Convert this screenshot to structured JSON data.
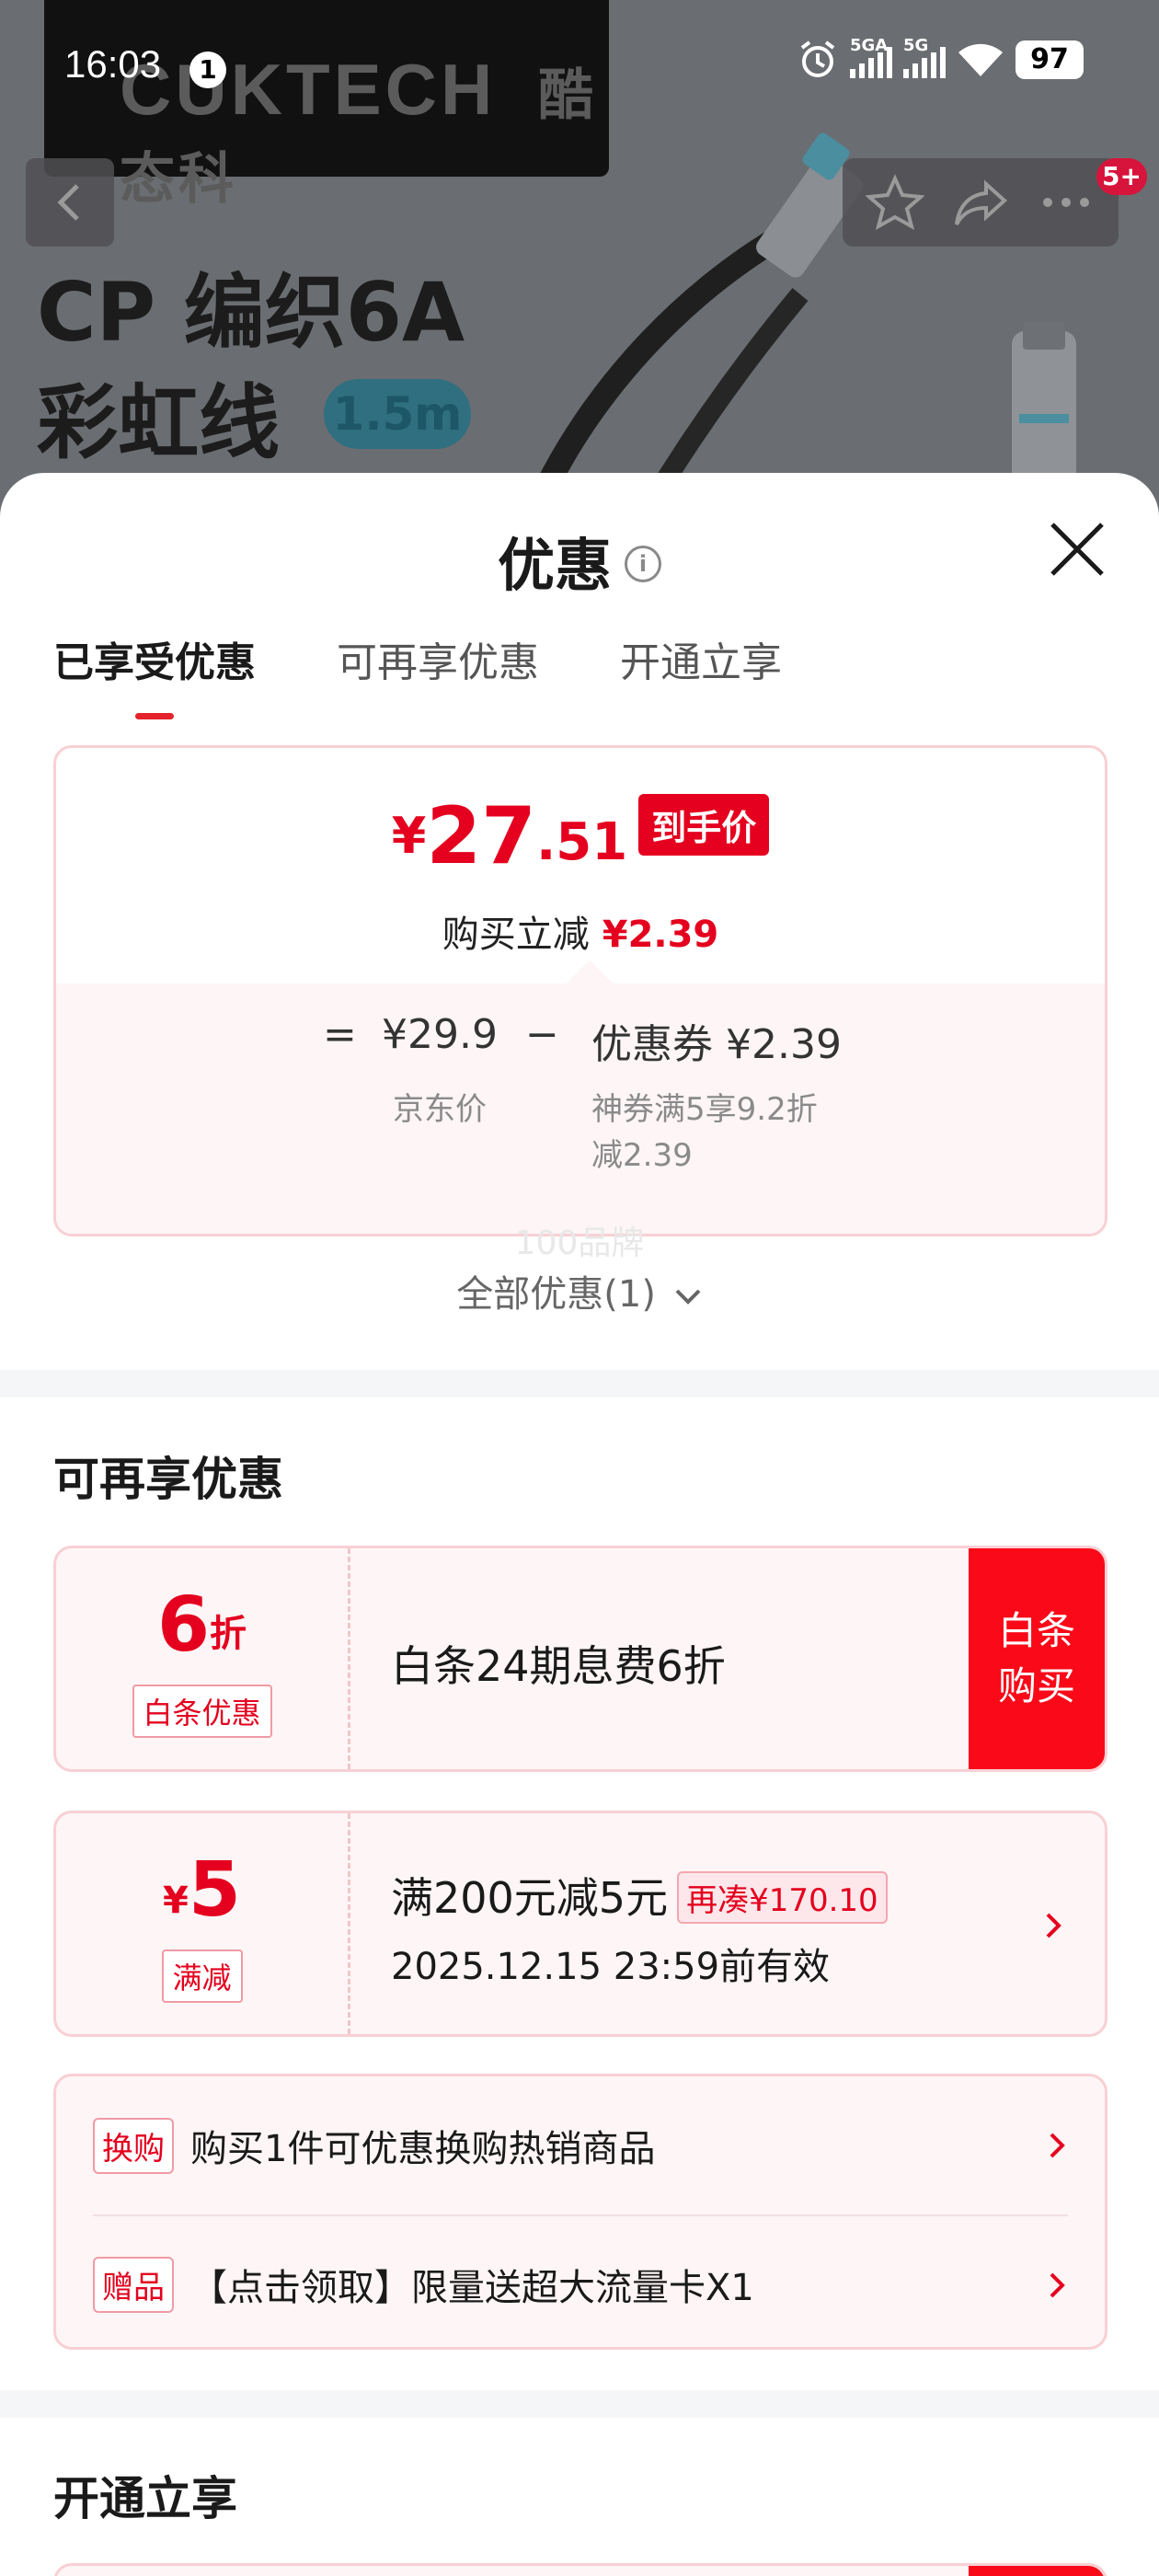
{
  "status_bar": {
    "time": "16:03",
    "notification_count": "1",
    "signal_1_label": "5GA",
    "signal_2_label": "5G",
    "battery": "97"
  },
  "product_image": {
    "logo_text": "CUKTECH",
    "logo_cn": "酷态科",
    "title_line1": "CP 编织6A",
    "title_line2": "彩虹线",
    "length_badge": "1.5m"
  },
  "top_bar": {
    "more_badge": "5+"
  },
  "sheet": {
    "title": "优惠",
    "info_icon_glyph": "i",
    "tabs": [
      "已享受优惠",
      "可再享优惠",
      "开通立享"
    ],
    "active_tab": 0
  },
  "enjoyed": {
    "price_yen": "¥",
    "price_int": "27",
    "price_dec": ".51",
    "price_tag": "到手价",
    "reduce_label": "购买立减",
    "reduce_value": "¥2.39",
    "formula_eq": "=",
    "jd_price": "¥29.9",
    "minus": "−",
    "coupon_label": "优惠券 ¥2.39",
    "jd_price_label": "京东价",
    "coupon_desc_line1": "神券满5享9.2折",
    "coupon_desc_line2": "减2.39"
  },
  "ghost_text": "100品牌",
  "all_offers_link": "全部优惠(1)",
  "more_offers": {
    "title": "可再享优惠",
    "baitiao": {
      "big": "6",
      "unit": "折",
      "tag": "白条优惠",
      "main": "白条24期息费6折",
      "action_line1": "白条",
      "action_line2": "购买"
    },
    "manjian": {
      "yen": "¥",
      "big": "5",
      "tag": "满减",
      "main": "满200元减5元",
      "pill": "再凑¥170.10",
      "sub": "2025.12.15 23:59前有效"
    },
    "gifts": [
      {
        "tag": "换购",
        "text": "购买1件可优惠换购热销商品"
      },
      {
        "tag": "赠品",
        "text": "【点击领取】限量送超大流量卡X1"
      }
    ]
  },
  "open_now": {
    "title": "开通立享"
  },
  "colors": {
    "accent_red": "#e4001e",
    "action_red": "#fa0a19",
    "soft_pink_bg": "#fdf5f6",
    "pink_border": "#f8d0d4"
  }
}
